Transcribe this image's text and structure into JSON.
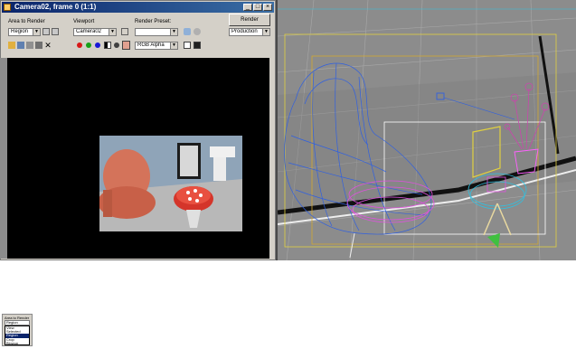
{
  "window": {
    "title": "Camera02, frame 0 (1:1)",
    "min": "_",
    "max": "□",
    "close": "×"
  },
  "controls": {
    "area_label": "Area to Render",
    "area_value": "Region",
    "viewport_label": "Viewport",
    "viewport_value": "Camera02",
    "preset_label": "Render Preset:",
    "preset_value": "",
    "render_button": "Render",
    "render_mode": "Production",
    "channel_value": "RGB Alpha"
  },
  "colors": {
    "title_bar": "#0a246a",
    "render_bg": "#000000",
    "viewport_bg": "#8c8c8c",
    "chair_wire": "#3060e0",
    "pouf_wire": "#e050e0",
    "table_wire": "#30c0e0",
    "vase_wire": "#ff60ff",
    "frame_wire": "#d4c830"
  },
  "channels": {
    "red": "#d81818",
    "green": "#18a018",
    "blue": "#1818d8"
  },
  "inset_dropdown": {
    "label": "Area to Render",
    "value": "Region",
    "options": [
      "View",
      "Selected",
      "Region",
      "Crop",
      "Blowup"
    ],
    "selected_index": 2
  }
}
